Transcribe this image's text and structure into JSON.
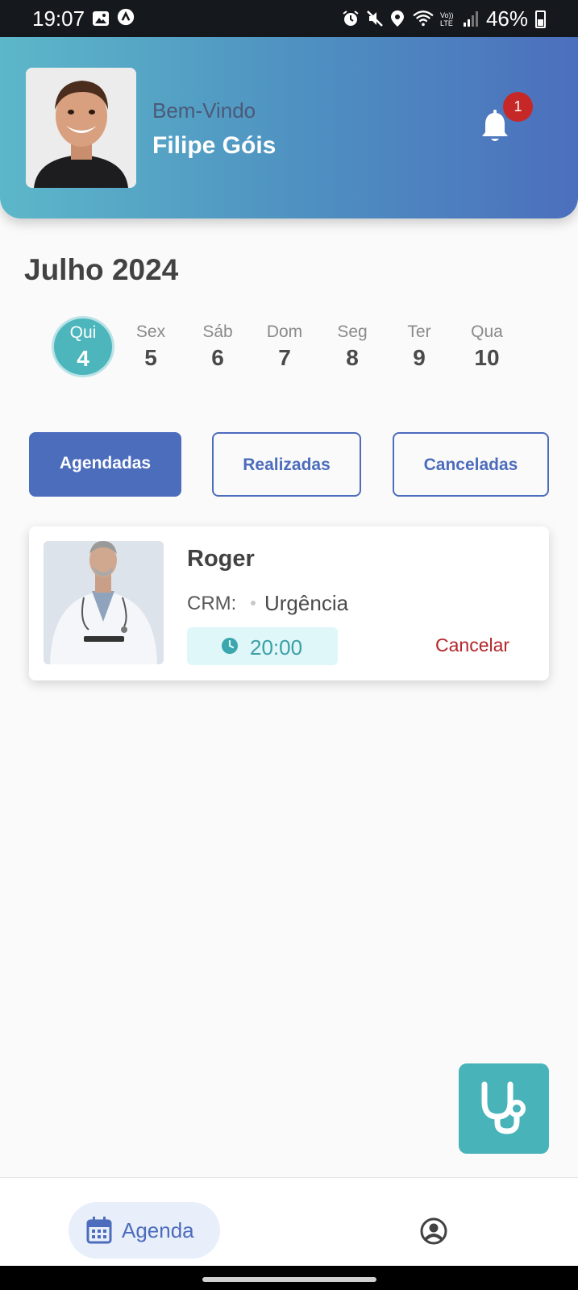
{
  "status_bar": {
    "time": "19:07",
    "battery": "46%"
  },
  "header": {
    "welcome": "Bem-Vindo",
    "user_name": "Filipe Góis",
    "notification_count": "1"
  },
  "calendar": {
    "month": "Julho 2024",
    "days": [
      {
        "name": "Qui",
        "date": "4",
        "selected": true
      },
      {
        "name": "Sex",
        "date": "5"
      },
      {
        "name": "Sáb",
        "date": "6"
      },
      {
        "name": "Dom",
        "date": "7"
      },
      {
        "name": "Seg",
        "date": "8"
      },
      {
        "name": "Ter",
        "date": "9"
      },
      {
        "name": "Qua",
        "date": "10"
      }
    ]
  },
  "filters": {
    "scheduled": "Agendadas",
    "done": "Realizadas",
    "cancelled": "Canceladas",
    "active": "Agendadas"
  },
  "appointment": {
    "doctor_name": "Roger",
    "crm_label": "CRM:",
    "specialty": "Urgência",
    "time": "20:00",
    "cancel_label": "Cancelar"
  },
  "bottom_nav": {
    "agenda_label": "Agenda"
  },
  "colors": {
    "primary": "#4c6cbc",
    "teal": "#48b3b8",
    "danger": "#b3262b"
  }
}
